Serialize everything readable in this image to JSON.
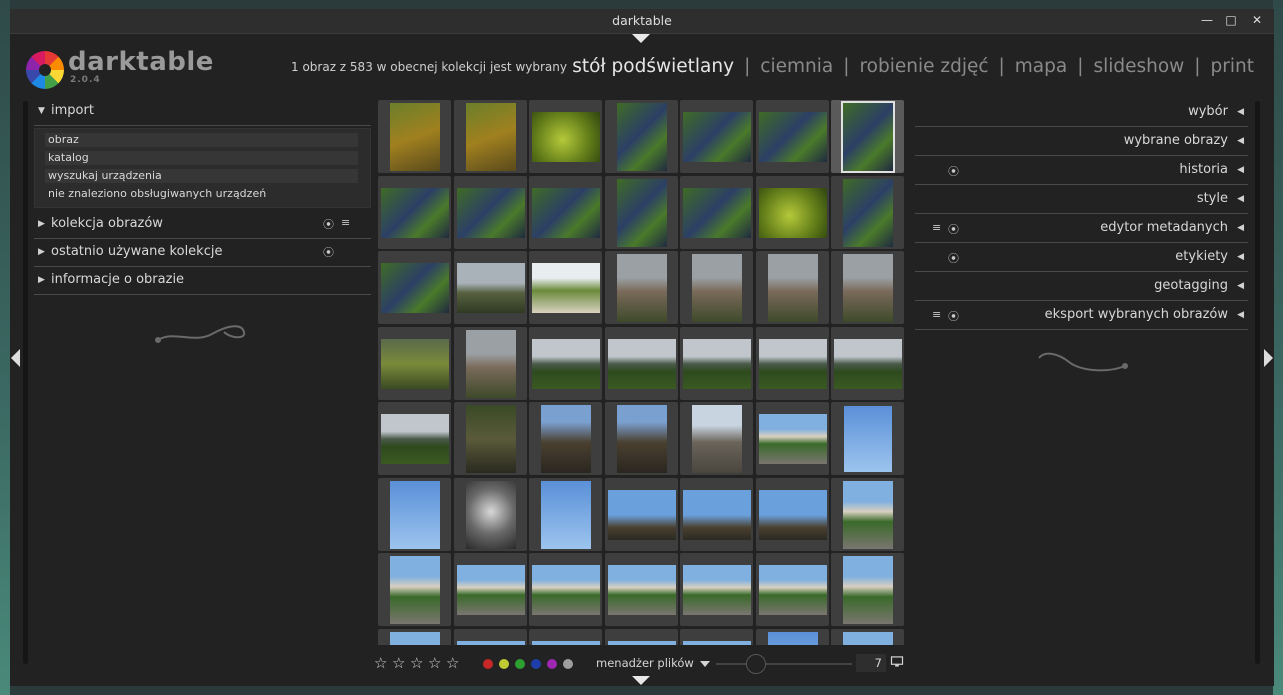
{
  "window": {
    "title": "darktable",
    "controls": [
      "minimize-icon",
      "maximize-icon",
      "close-icon"
    ]
  },
  "header": {
    "app_name": "darktable",
    "version": "2.0.4",
    "selection_status": "1 obraz z 583 w obecnej kolekcji jest wybrany",
    "views": [
      {
        "label": "stół podświetlany",
        "active": true
      },
      {
        "label": "ciemnia",
        "active": false
      },
      {
        "label": "robienie zdjęć",
        "active": false
      },
      {
        "label": "mapa",
        "active": false
      },
      {
        "label": "slideshow",
        "active": false
      },
      {
        "label": "print",
        "active": false
      }
    ],
    "separator": "|"
  },
  "left_panel": {
    "import": {
      "label": "import",
      "items": [
        "obraz",
        "katalog",
        "wyszukaj urządzenia"
      ],
      "note": "nie znaleziono obsługiwanych urządzeń"
    },
    "modules": [
      {
        "label": "kolekcja obrazów",
        "icons": [
          "reset-icon",
          "presets-icon"
        ]
      },
      {
        "label": "ostatnio używane kolekcje",
        "icons": [
          "reset-icon"
        ]
      },
      {
        "label": "informacje o obrazie",
        "icons": []
      }
    ]
  },
  "right_panel": {
    "modules": [
      {
        "label": "wybór",
        "icons": []
      },
      {
        "label": "wybrane obrazy",
        "icons": []
      },
      {
        "label": "historia",
        "icons": [
          "reset-icon"
        ]
      },
      {
        "label": "style",
        "icons": []
      },
      {
        "label": "edytor metadanych",
        "icons": [
          "presets-icon",
          "reset-icon"
        ]
      },
      {
        "label": "etykiety",
        "icons": [
          "reset-icon"
        ]
      },
      {
        "label": "geotagging",
        "icons": []
      },
      {
        "label": "eksport wybranych obrazów",
        "icons": [
          "presets-icon",
          "reset-icon"
        ]
      }
    ]
  },
  "bottom_bar": {
    "stars": 5,
    "color_labels": [
      "#c62828",
      "#c0ca33",
      "#2e9e32",
      "#1e3fa8",
      "#9c27b0",
      "#9e9e9e"
    ],
    "layout_label": "menadżer plików",
    "zoom_value": "7"
  },
  "thumbnails": {
    "columns": 7,
    "selected_index": 6,
    "rows": [
      [
        "vineyard",
        "vineyard",
        "grapes-green",
        "grapes",
        "grapes",
        "grapes",
        "grapes"
      ],
      [
        "grapes",
        "grapes",
        "grapes",
        "grapes",
        "grapes",
        "grapes-green",
        "grapes"
      ],
      [
        "grapes",
        "landscape",
        "river",
        "church",
        "church",
        "church",
        "church"
      ],
      [
        "garden",
        "church",
        "field",
        "field",
        "field",
        "field",
        "field"
      ],
      [
        "field",
        "ruins",
        "people",
        "people",
        "well",
        "street",
        "statue-sky"
      ],
      [
        "statue-sky",
        "carving",
        "statue-sky",
        "monument",
        "monument",
        "monument",
        "street"
      ],
      [
        "street",
        "street",
        "street",
        "street",
        "street",
        "street",
        "street"
      ],
      [
        "street",
        "street",
        "street",
        "street",
        "street",
        "statue-sky",
        "street"
      ]
    ]
  }
}
